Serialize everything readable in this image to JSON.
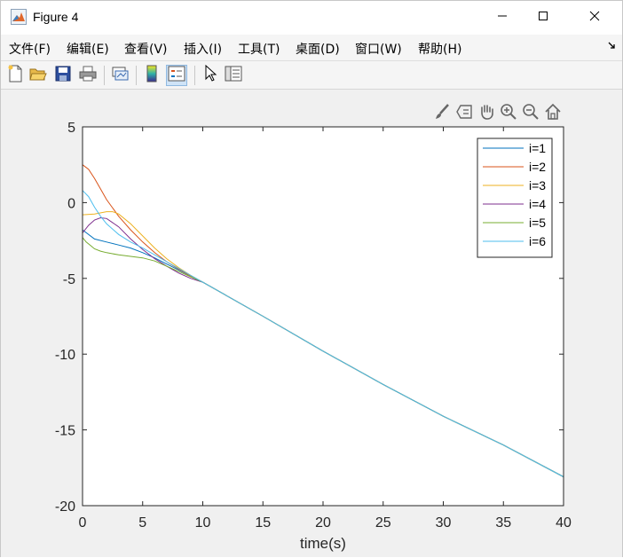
{
  "window": {
    "title": "Figure 4",
    "icons": {
      "app": "matlab-icon",
      "minimize": "minimize-icon",
      "maximize": "maximize-icon",
      "close": "close-icon"
    }
  },
  "menu": {
    "items": [
      "文件(F)",
      "编辑(E)",
      "查看(V)",
      "插入(I)",
      "工具(T)",
      "桌面(D)",
      "窗口(W)",
      "帮助(H)"
    ],
    "overflow_icon": "dock-arrow-icon"
  },
  "toolbar": {
    "icons": [
      "new-figure-icon",
      "open-file-icon",
      "save-icon",
      "print-icon",
      "link-plot-icon",
      "colorbar-icon",
      "legend-icon",
      "pointer-icon",
      "property-inspector-icon"
    ]
  },
  "axes_toolbar": {
    "icons": [
      "brush-icon",
      "data-tip-icon",
      "pan-icon",
      "zoom-in-icon",
      "zoom-out-icon",
      "home-icon"
    ]
  },
  "chart_data": {
    "type": "line",
    "title": "",
    "xlabel": "time(s)",
    "ylabel": "",
    "xlim": [
      0,
      40
    ],
    "ylim": [
      -20,
      5
    ],
    "xticks": [
      0,
      5,
      10,
      15,
      20,
      25,
      30,
      35,
      40
    ],
    "yticks": [
      5,
      0,
      -5,
      -10,
      -15,
      -20
    ],
    "grid": false,
    "legend_position": "top-right",
    "series": [
      {
        "name": "i=1",
        "color": "#0072BD",
        "x": [
          0,
          1,
          2,
          3,
          4,
          5,
          6,
          7,
          8,
          9,
          10,
          15,
          20,
          25,
          30,
          35,
          40
        ],
        "y": [
          -1.8,
          -2.4,
          -2.6,
          -2.8,
          -3.0,
          -3.3,
          -3.65,
          -4.05,
          -4.45,
          -4.85,
          -5.25,
          -7.5,
          -9.8,
          -12.0,
          -14.1,
          -16.0,
          -18.1
        ]
      },
      {
        "name": "i=2",
        "color": "#D95319",
        "x": [
          0,
          0.5,
          1,
          1.5,
          2,
          3,
          4,
          5,
          6,
          7,
          8,
          9,
          10,
          15,
          20,
          25,
          30,
          35,
          40
        ],
        "y": [
          2.5,
          2.2,
          1.6,
          0.9,
          0.2,
          -0.9,
          -1.8,
          -2.6,
          -3.3,
          -3.9,
          -4.4,
          -4.85,
          -5.25,
          -7.5,
          -9.8,
          -12.0,
          -14.1,
          -16.0,
          -18.1
        ]
      },
      {
        "name": "i=3",
        "color": "#EDB120",
        "x": [
          0,
          1,
          2,
          2.5,
          3,
          4,
          5,
          6,
          7,
          8,
          9,
          10,
          15,
          20,
          25,
          30,
          35,
          40
        ],
        "y": [
          -0.8,
          -0.75,
          -0.6,
          -0.6,
          -0.75,
          -1.4,
          -2.2,
          -3.0,
          -3.7,
          -4.3,
          -4.8,
          -5.25,
          -7.5,
          -9.8,
          -12.0,
          -14.1,
          -16.0,
          -18.1
        ]
      },
      {
        "name": "i=4",
        "color": "#7E2F8E",
        "x": [
          0,
          0.5,
          1,
          1.5,
          2,
          3,
          4,
          5,
          6,
          7,
          8,
          9,
          10,
          15,
          20,
          25,
          30,
          35,
          40
        ],
        "y": [
          -2.0,
          -1.5,
          -1.15,
          -1.0,
          -1.05,
          -1.6,
          -2.4,
          -3.1,
          -3.7,
          -4.2,
          -4.65,
          -5.0,
          -5.25,
          -7.5,
          -9.8,
          -12.0,
          -14.1,
          -16.0,
          -18.1
        ]
      },
      {
        "name": "i=5",
        "color": "#77AC30",
        "x": [
          0,
          0.3,
          0.7,
          1,
          1.5,
          2,
          3,
          4,
          5,
          6,
          7,
          8,
          9,
          10,
          15,
          20,
          25,
          30,
          35,
          40
        ],
        "y": [
          -2.3,
          -2.6,
          -2.85,
          -3.05,
          -3.2,
          -3.3,
          -3.45,
          -3.55,
          -3.65,
          -3.85,
          -4.2,
          -4.55,
          -4.9,
          -5.25,
          -7.5,
          -9.8,
          -12.0,
          -14.1,
          -16.0,
          -18.1
        ]
      },
      {
        "name": "i=6",
        "color": "#4DBEEE",
        "x": [
          0,
          0.5,
          1,
          1.5,
          2,
          3,
          4,
          5,
          6,
          7,
          8,
          9,
          10,
          15,
          20,
          25,
          30,
          35,
          40
        ],
        "y": [
          0.8,
          0.4,
          -0.3,
          -0.9,
          -1.4,
          -2.1,
          -2.6,
          -3.0,
          -3.45,
          -3.9,
          -4.35,
          -4.8,
          -5.25,
          -7.5,
          -9.8,
          -12.0,
          -14.1,
          -16.0,
          -18.1
        ]
      }
    ]
  }
}
